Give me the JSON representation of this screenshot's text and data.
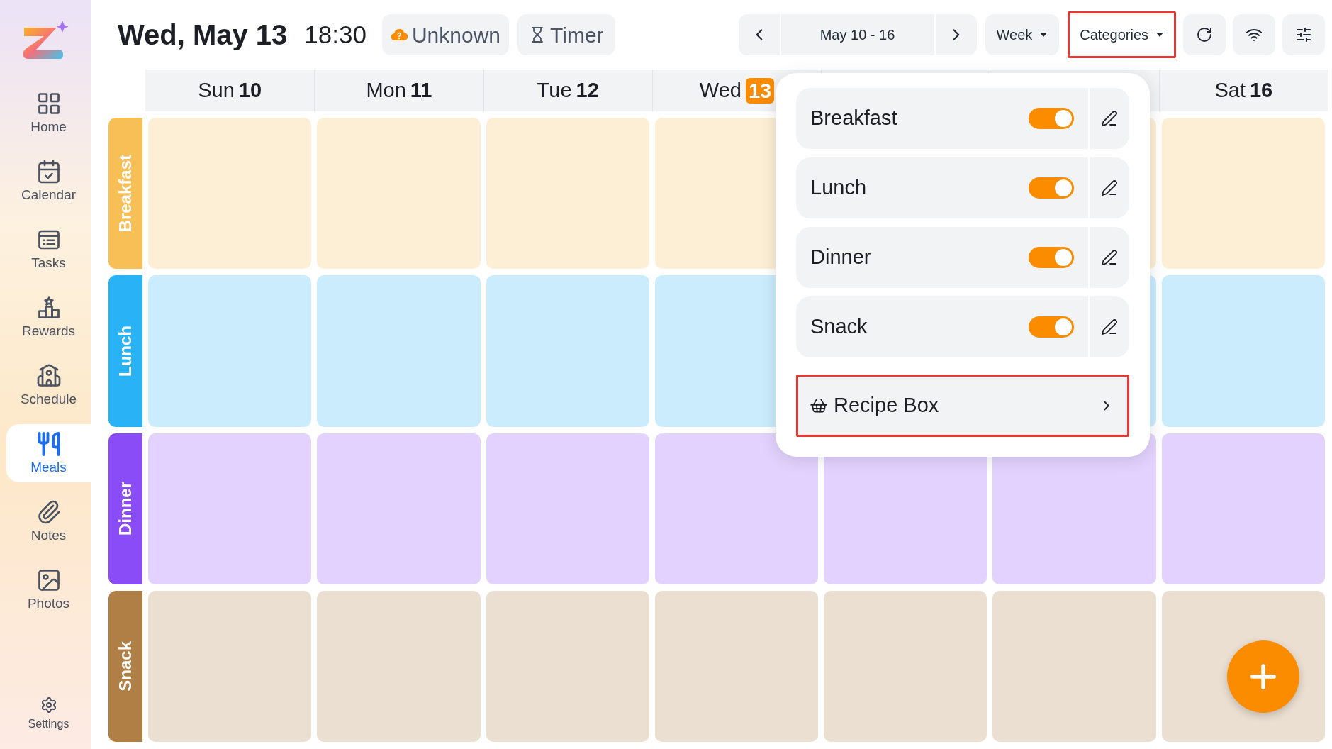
{
  "sidebar": {
    "items": [
      {
        "label": "Home",
        "selected": false
      },
      {
        "label": "Calendar",
        "selected": false
      },
      {
        "label": "Tasks",
        "selected": false
      },
      {
        "label": "Rewards",
        "selected": false
      },
      {
        "label": "Schedule",
        "selected": false
      },
      {
        "label": "Meals",
        "selected": true
      },
      {
        "label": "Notes",
        "selected": false
      },
      {
        "label": "Photos",
        "selected": false
      }
    ],
    "settings": {
      "label": "Settings",
      "selected": false
    }
  },
  "header": {
    "date": "Wed, May 13",
    "time": "18:30",
    "weather": "Unknown",
    "timer": "Timer",
    "range": "May 10 - 16",
    "view": "Week",
    "categories": {
      "label": "Categories",
      "highlighted": true
    }
  },
  "days": [
    {
      "name": "Sun",
      "number": "10",
      "today": false
    },
    {
      "name": "Mon",
      "number": "11",
      "today": false
    },
    {
      "name": "Tue",
      "number": "12",
      "today": false
    },
    {
      "name": "Wed",
      "number": "13",
      "today": true
    },
    {
      "name": "Sat",
      "number": "16",
      "today": false
    }
  ],
  "meals": [
    {
      "label": "Breakfast",
      "color": "#f7bf56"
    },
    {
      "label": "Lunch",
      "color": "#2ab2f6"
    },
    {
      "label": "Dinner",
      "color": "#8a4cf6"
    },
    {
      "label": "Snack",
      "color": "#b07f45"
    }
  ],
  "categories_menu": {
    "items": [
      {
        "name": "Breakfast",
        "on": true
      },
      {
        "name": "Lunch",
        "on": true
      },
      {
        "name": "Dinner",
        "on": true
      },
      {
        "name": "Snack",
        "on": true
      }
    ],
    "recipe_box": {
      "label": "Recipe Box",
      "highlighted": true
    }
  }
}
